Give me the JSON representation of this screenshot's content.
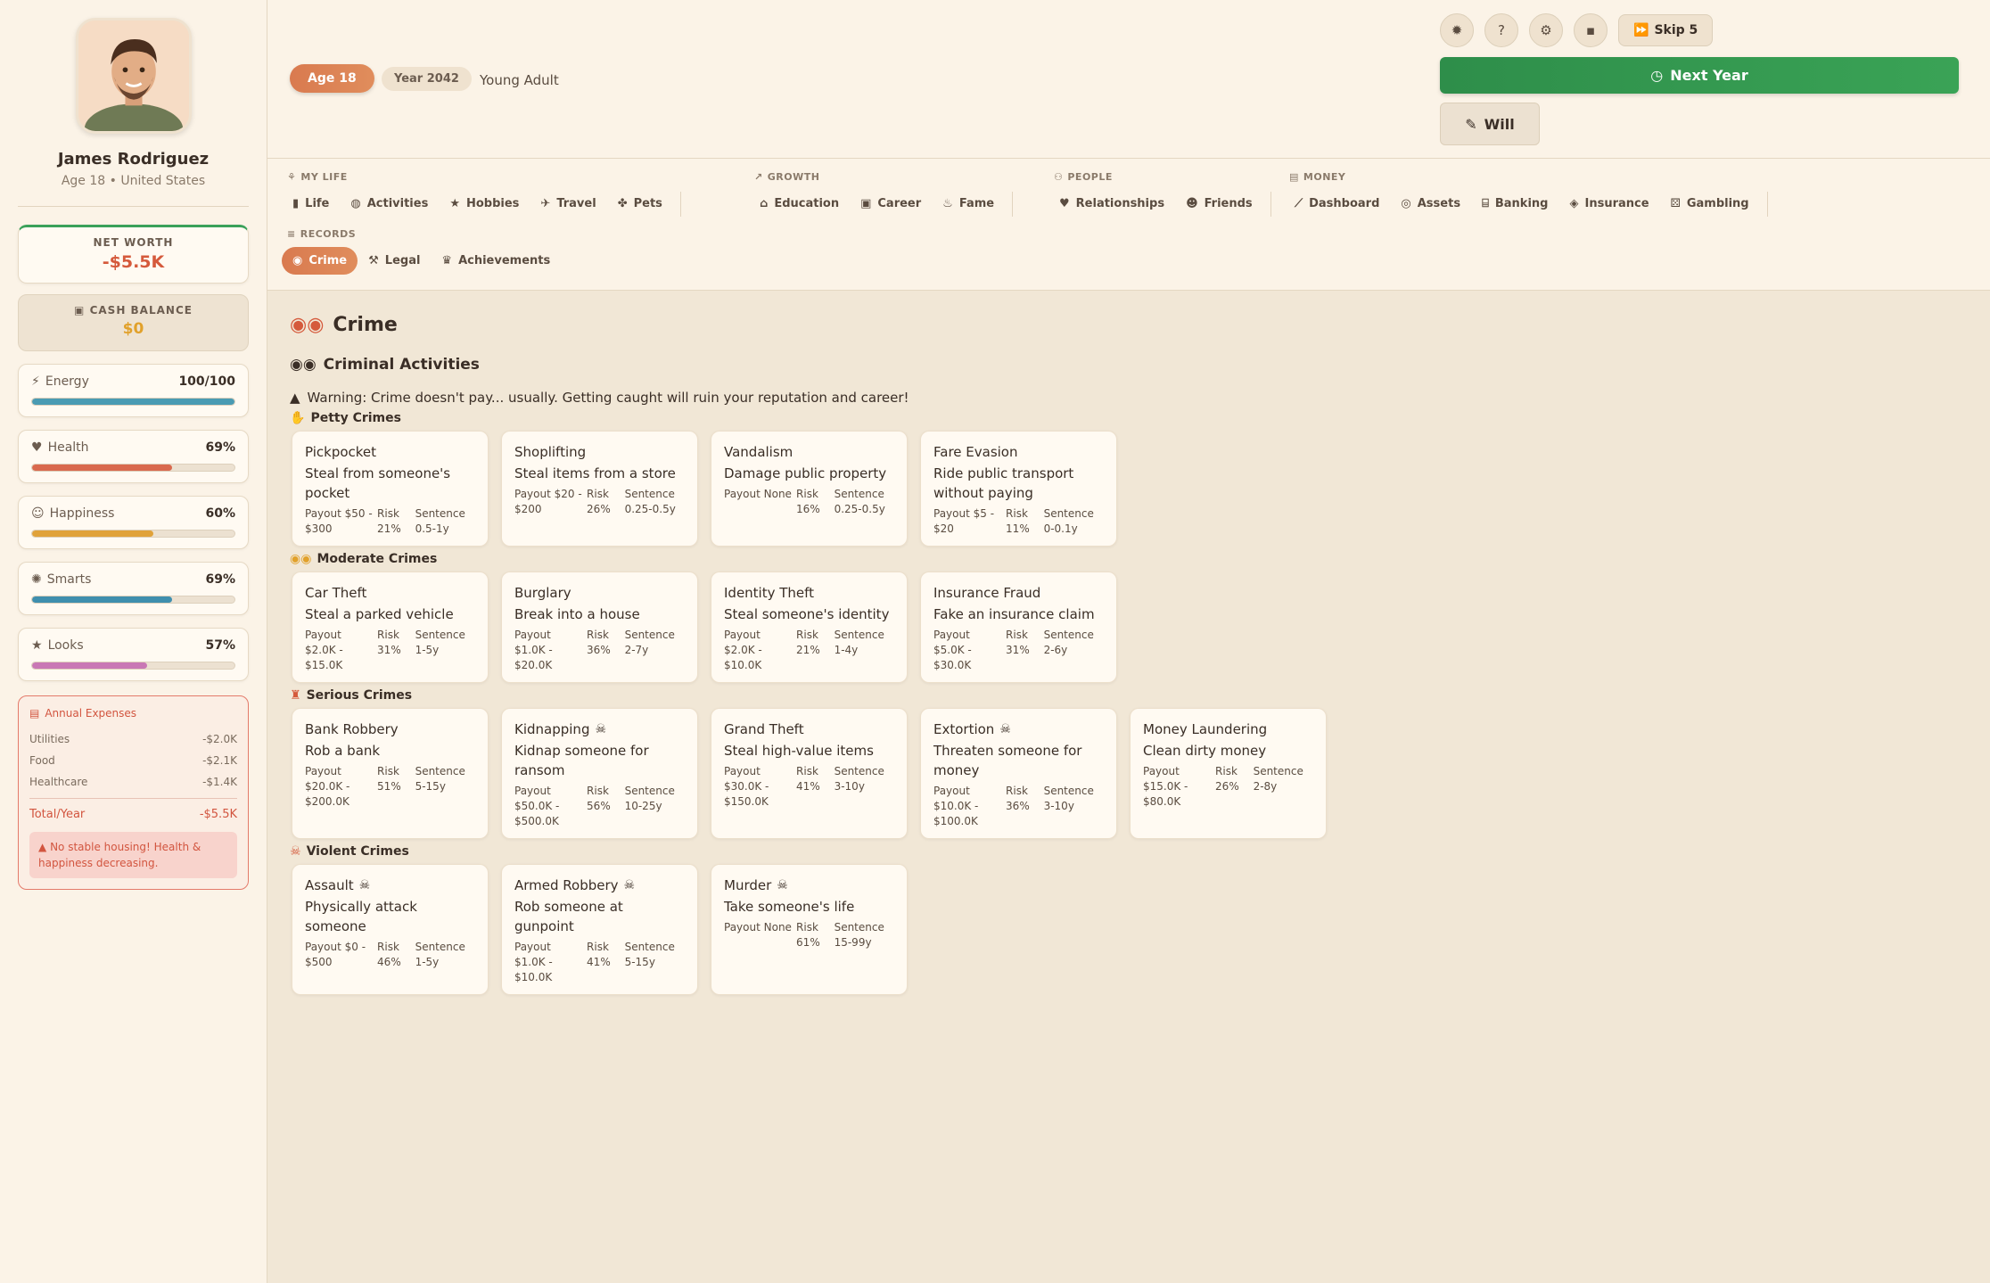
{
  "player": {
    "name": "James Rodriguez",
    "subtitle": "Age 18 • United States"
  },
  "finance": {
    "networth_label": "NET WORTH",
    "networth_value": "-$5.5K",
    "cash_label": "CASH BALANCE",
    "cash_value": "$0"
  },
  "stats": [
    {
      "name": "Energy",
      "value": "100/100",
      "fill": 1.0,
      "color": "#4a9bb3",
      "icon": "lightning-icon"
    },
    {
      "name": "Health",
      "value": "69%",
      "fill": 0.69,
      "color": "#d9694e",
      "icon": "heart-icon"
    },
    {
      "name": "Happiness",
      "value": "60%",
      "fill": 0.6,
      "color": "#e0a23a",
      "icon": "smile-icon"
    },
    {
      "name": "Smarts",
      "value": "69%",
      "fill": 0.69,
      "color": "#3f8fae",
      "icon": "brain-icon"
    },
    {
      "name": "Looks",
      "value": "57%",
      "fill": 0.57,
      "color": "#c978b5",
      "icon": "star-icon"
    }
  ],
  "expenses": {
    "title": "Annual Expenses",
    "rows": [
      {
        "label": "Utilities",
        "value": "-$2.0K"
      },
      {
        "label": "Food",
        "value": "-$2.1K"
      },
      {
        "label": "Healthcare",
        "value": "-$1.4K"
      }
    ],
    "total_label": "Total/Year",
    "total_value": "-$5.5K",
    "warning": "No stable housing! Health & happiness decreasing."
  },
  "topbar": {
    "age": "Age 18",
    "year": "Year 2042",
    "stage": "Young Adult",
    "skip_label": "Skip 5",
    "next_year_label": "Next Year",
    "will_label": "Will"
  },
  "nav": {
    "my_life": {
      "label": "MY LIFE",
      "items": [
        "Life",
        "Activities",
        "Hobbies",
        "Travel",
        "Pets"
      ]
    },
    "growth": {
      "label": "GROWTH",
      "items": [
        "Education",
        "Career",
        "Fame"
      ]
    },
    "people": {
      "label": "PEOPLE",
      "items": [
        "Relationships",
        "Friends"
      ]
    },
    "money": {
      "label": "MONEY",
      "items": [
        "Dashboard",
        "Assets",
        "Banking",
        "Insurance",
        "Gambling"
      ]
    },
    "records": {
      "label": "RECORDS",
      "items": [
        "Crime",
        "Legal",
        "Achievements"
      ]
    }
  },
  "content": {
    "page_title": "Crime",
    "section_title": "Criminal Activities",
    "warning": "Warning: Crime doesn't pay... usually. Getting caught will ruin your reputation and career!",
    "categories": [
      {
        "title": "Petty Crimes",
        "crimes": [
          {
            "name": "Pickpocket",
            "desc": "Steal from someone's pocket",
            "pay": "Payout $50 - $300",
            "risk": "Risk 21%",
            "sentence": "Sentence 0.5-1y",
            "skull": false
          },
          {
            "name": "Shoplifting",
            "desc": "Steal items from a store",
            "pay": "Payout $20 - $200",
            "risk": "Risk 26%",
            "sentence": "Sentence 0.25-0.5y",
            "skull": false
          },
          {
            "name": "Vandalism",
            "desc": "Damage public property",
            "pay": "Payout None",
            "risk": "Risk 16%",
            "sentence": "Sentence 0.25-0.5y",
            "skull": false
          },
          {
            "name": "Fare Evasion",
            "desc": "Ride public transport without paying",
            "pay": "Payout $5 - $20",
            "risk": "Risk 11%",
            "sentence": "Sentence 0-0.1y",
            "skull": false
          }
        ]
      },
      {
        "title": "Moderate Crimes",
        "crimes": [
          {
            "name": "Car Theft",
            "desc": "Steal a parked vehicle",
            "pay": "Payout $2.0K - $15.0K",
            "risk": "Risk 31%",
            "sentence": "Sentence 1-5y",
            "skull": false
          },
          {
            "name": "Burglary",
            "desc": "Break into a house",
            "pay": "Payout $1.0K - $20.0K",
            "risk": "Risk 36%",
            "sentence": "Sentence 2-7y",
            "skull": false
          },
          {
            "name": "Identity Theft",
            "desc": "Steal someone's identity",
            "pay": "Payout $2.0K - $10.0K",
            "risk": "Risk 21%",
            "sentence": "Sentence 1-4y",
            "skull": false
          },
          {
            "name": "Insurance Fraud",
            "desc": "Fake an insurance claim",
            "pay": "Payout $5.0K - $30.0K",
            "risk": "Risk 31%",
            "sentence": "Sentence 2-6y",
            "skull": false
          }
        ]
      },
      {
        "title": "Serious Crimes",
        "crimes": [
          {
            "name": "Bank Robbery",
            "desc": "Rob a bank",
            "pay": "Payout $20.0K - $200.0K",
            "risk": "Risk 51%",
            "sentence": "Sentence 5-15y",
            "skull": false
          },
          {
            "name": "Kidnapping",
            "desc": "Kidnap someone for ransom",
            "pay": "Payout $50.0K - $500.0K",
            "risk": "Risk 56%",
            "sentence": "Sentence 10-25y",
            "skull": true
          },
          {
            "name": "Grand Theft",
            "desc": "Steal high-value items",
            "pay": "Payout $30.0K - $150.0K",
            "risk": "Risk 41%",
            "sentence": "Sentence 3-10y",
            "skull": false
          },
          {
            "name": "Extortion",
            "desc": "Threaten someone for money",
            "pay": "Payout $10.0K - $100.0K",
            "risk": "Risk 36%",
            "sentence": "Sentence 3-10y",
            "skull": true
          },
          {
            "name": "Money Laundering",
            "desc": "Clean dirty money",
            "pay": "Payout $15.0K - $80.0K",
            "risk": "Risk 26%",
            "sentence": "Sentence 2-8y",
            "skull": false
          }
        ]
      },
      {
        "title": "Violent Crimes",
        "crimes": [
          {
            "name": "Assault",
            "desc": "Physically attack someone",
            "pay": "Payout $0 - $500",
            "risk": "Risk 46%",
            "sentence": "Sentence 1-5y",
            "skull": true
          },
          {
            "name": "Armed Robbery",
            "desc": "Rob someone at gunpoint",
            "pay": "Payout $1.0K - $10.0K",
            "risk": "Risk 41%",
            "sentence": "Sentence 5-15y",
            "skull": true
          },
          {
            "name": "Murder",
            "desc": "Take someone's life",
            "pay": "Payout None",
            "risk": "Risk 61%",
            "sentence": "Sentence 15-99y",
            "skull": true
          }
        ]
      }
    ]
  }
}
